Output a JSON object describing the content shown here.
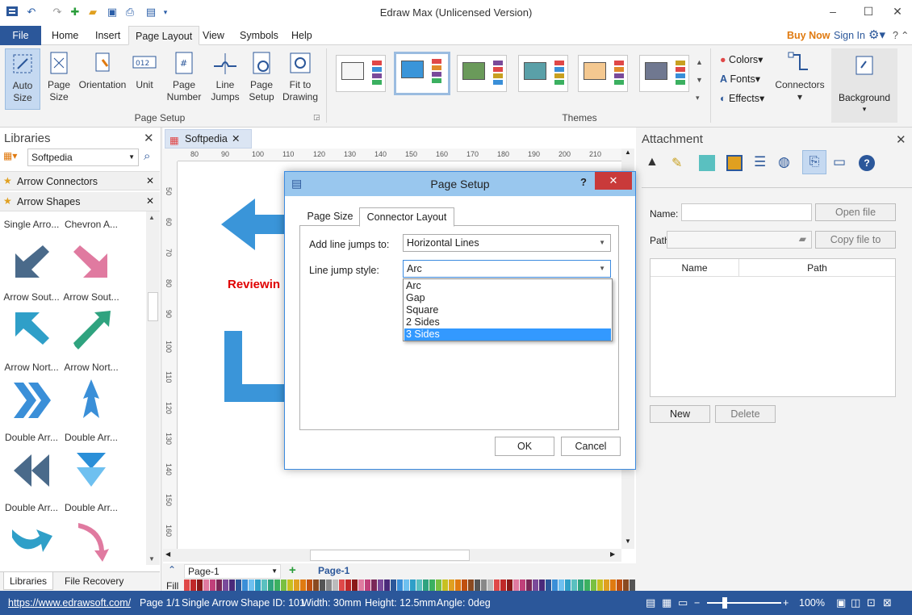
{
  "app": {
    "title": "Edraw Max (Unlicensed Version)"
  },
  "quick_access": [
    "undo-icon",
    "redo-icon",
    "new-icon",
    "open-icon",
    "save-icon",
    "print-icon"
  ],
  "window": {
    "minimize": "–",
    "maximize": "☐",
    "close": "✕"
  },
  "tabs": [
    "File",
    "Home",
    "Insert",
    "Page Layout",
    "View",
    "Symbols",
    "Help"
  ],
  "topright": {
    "buy_now": "Buy Now",
    "sign_in": "Sign In"
  },
  "ribbon": {
    "page_setup": {
      "group_label": "Page Setup",
      "auto_size": "Auto Size",
      "page_size": "Page Size",
      "orientation": "Orientation",
      "unit": "Unit",
      "page_number": "Page Number",
      "line_jumps": "Line Jumps",
      "page_setup_btn": "Page Setup",
      "fit_to_drawing": "Fit to Drawing"
    },
    "themes": {
      "group_label": "Themes"
    },
    "colors": "Colors",
    "fonts": "Fonts",
    "effects": "Effects",
    "connectors": "Connectors",
    "background": "Background"
  },
  "libraries": {
    "title": "Libraries",
    "selected_library": "Softpedia",
    "groups": [
      "Arrow Connectors",
      "Arrow Shapes"
    ],
    "items": [
      "Single Arro...",
      "Chevron A...",
      "Arrow Sout...",
      "Arrow Sout...",
      "Arrow Nort...",
      "Arrow Nort...",
      "Double Arr...",
      "Double Arr...",
      "Double Arr...",
      "Double Arr..."
    ],
    "bottom_tabs": [
      "Libraries",
      "File Recovery"
    ]
  },
  "document": {
    "tab": "Softpedia",
    "canvas_text": "Reviewin",
    "ruler_h": [
      "80",
      "90",
      "100",
      "110",
      "120",
      "130",
      "140",
      "150",
      "160",
      "170",
      "180",
      "190",
      "200",
      "210"
    ],
    "ruler_v": [
      "50",
      "60",
      "70",
      "80",
      "90",
      "100",
      "110",
      "120",
      "130",
      "140",
      "150",
      "160"
    ],
    "page_selector": "Page-1",
    "page_tab": "Page-1",
    "fill_label": "Fill"
  },
  "attachment": {
    "title": "Attachment",
    "name_label": "Name:",
    "path_label": "Path:",
    "open_file": "Open file",
    "copy_file": "Copy file to",
    "col_name": "Name",
    "col_path": "Path",
    "new": "New",
    "delete": "Delete"
  },
  "dialog": {
    "title": "Page Setup",
    "help": "?",
    "tabs": [
      "Page Size",
      "Connector Layout"
    ],
    "add_line_jumps_label": "Add line jumps to:",
    "add_line_jumps_value": "Horizontal Lines",
    "line_jump_style_label": "Line jump style:",
    "line_jump_style_value": "Arc",
    "options": [
      "Arc",
      "Gap",
      "Square",
      "2 Sides",
      "3 Sides"
    ],
    "selected_option": "3 Sides",
    "ok": "OK",
    "cancel": "Cancel"
  },
  "status": {
    "url": "https://www.edrawsoft.com/",
    "page": "Page 1/1",
    "shape": "Single Arrow",
    "shape_id": "Shape ID: 101",
    "width": "Width: 30mm",
    "height": "Height: 12.5mm",
    "angle": "Angle: 0deg",
    "zoom": "100%"
  },
  "colors": {
    "accent": "#2b579a",
    "arrow_blue": "#3a95d9",
    "arrow_pink": "#e07aa0",
    "arrow_green": "#2fa37f",
    "buy_now": "#e07a10",
    "selected_option": "#3399ff",
    "canvas_text": "#e00000"
  }
}
